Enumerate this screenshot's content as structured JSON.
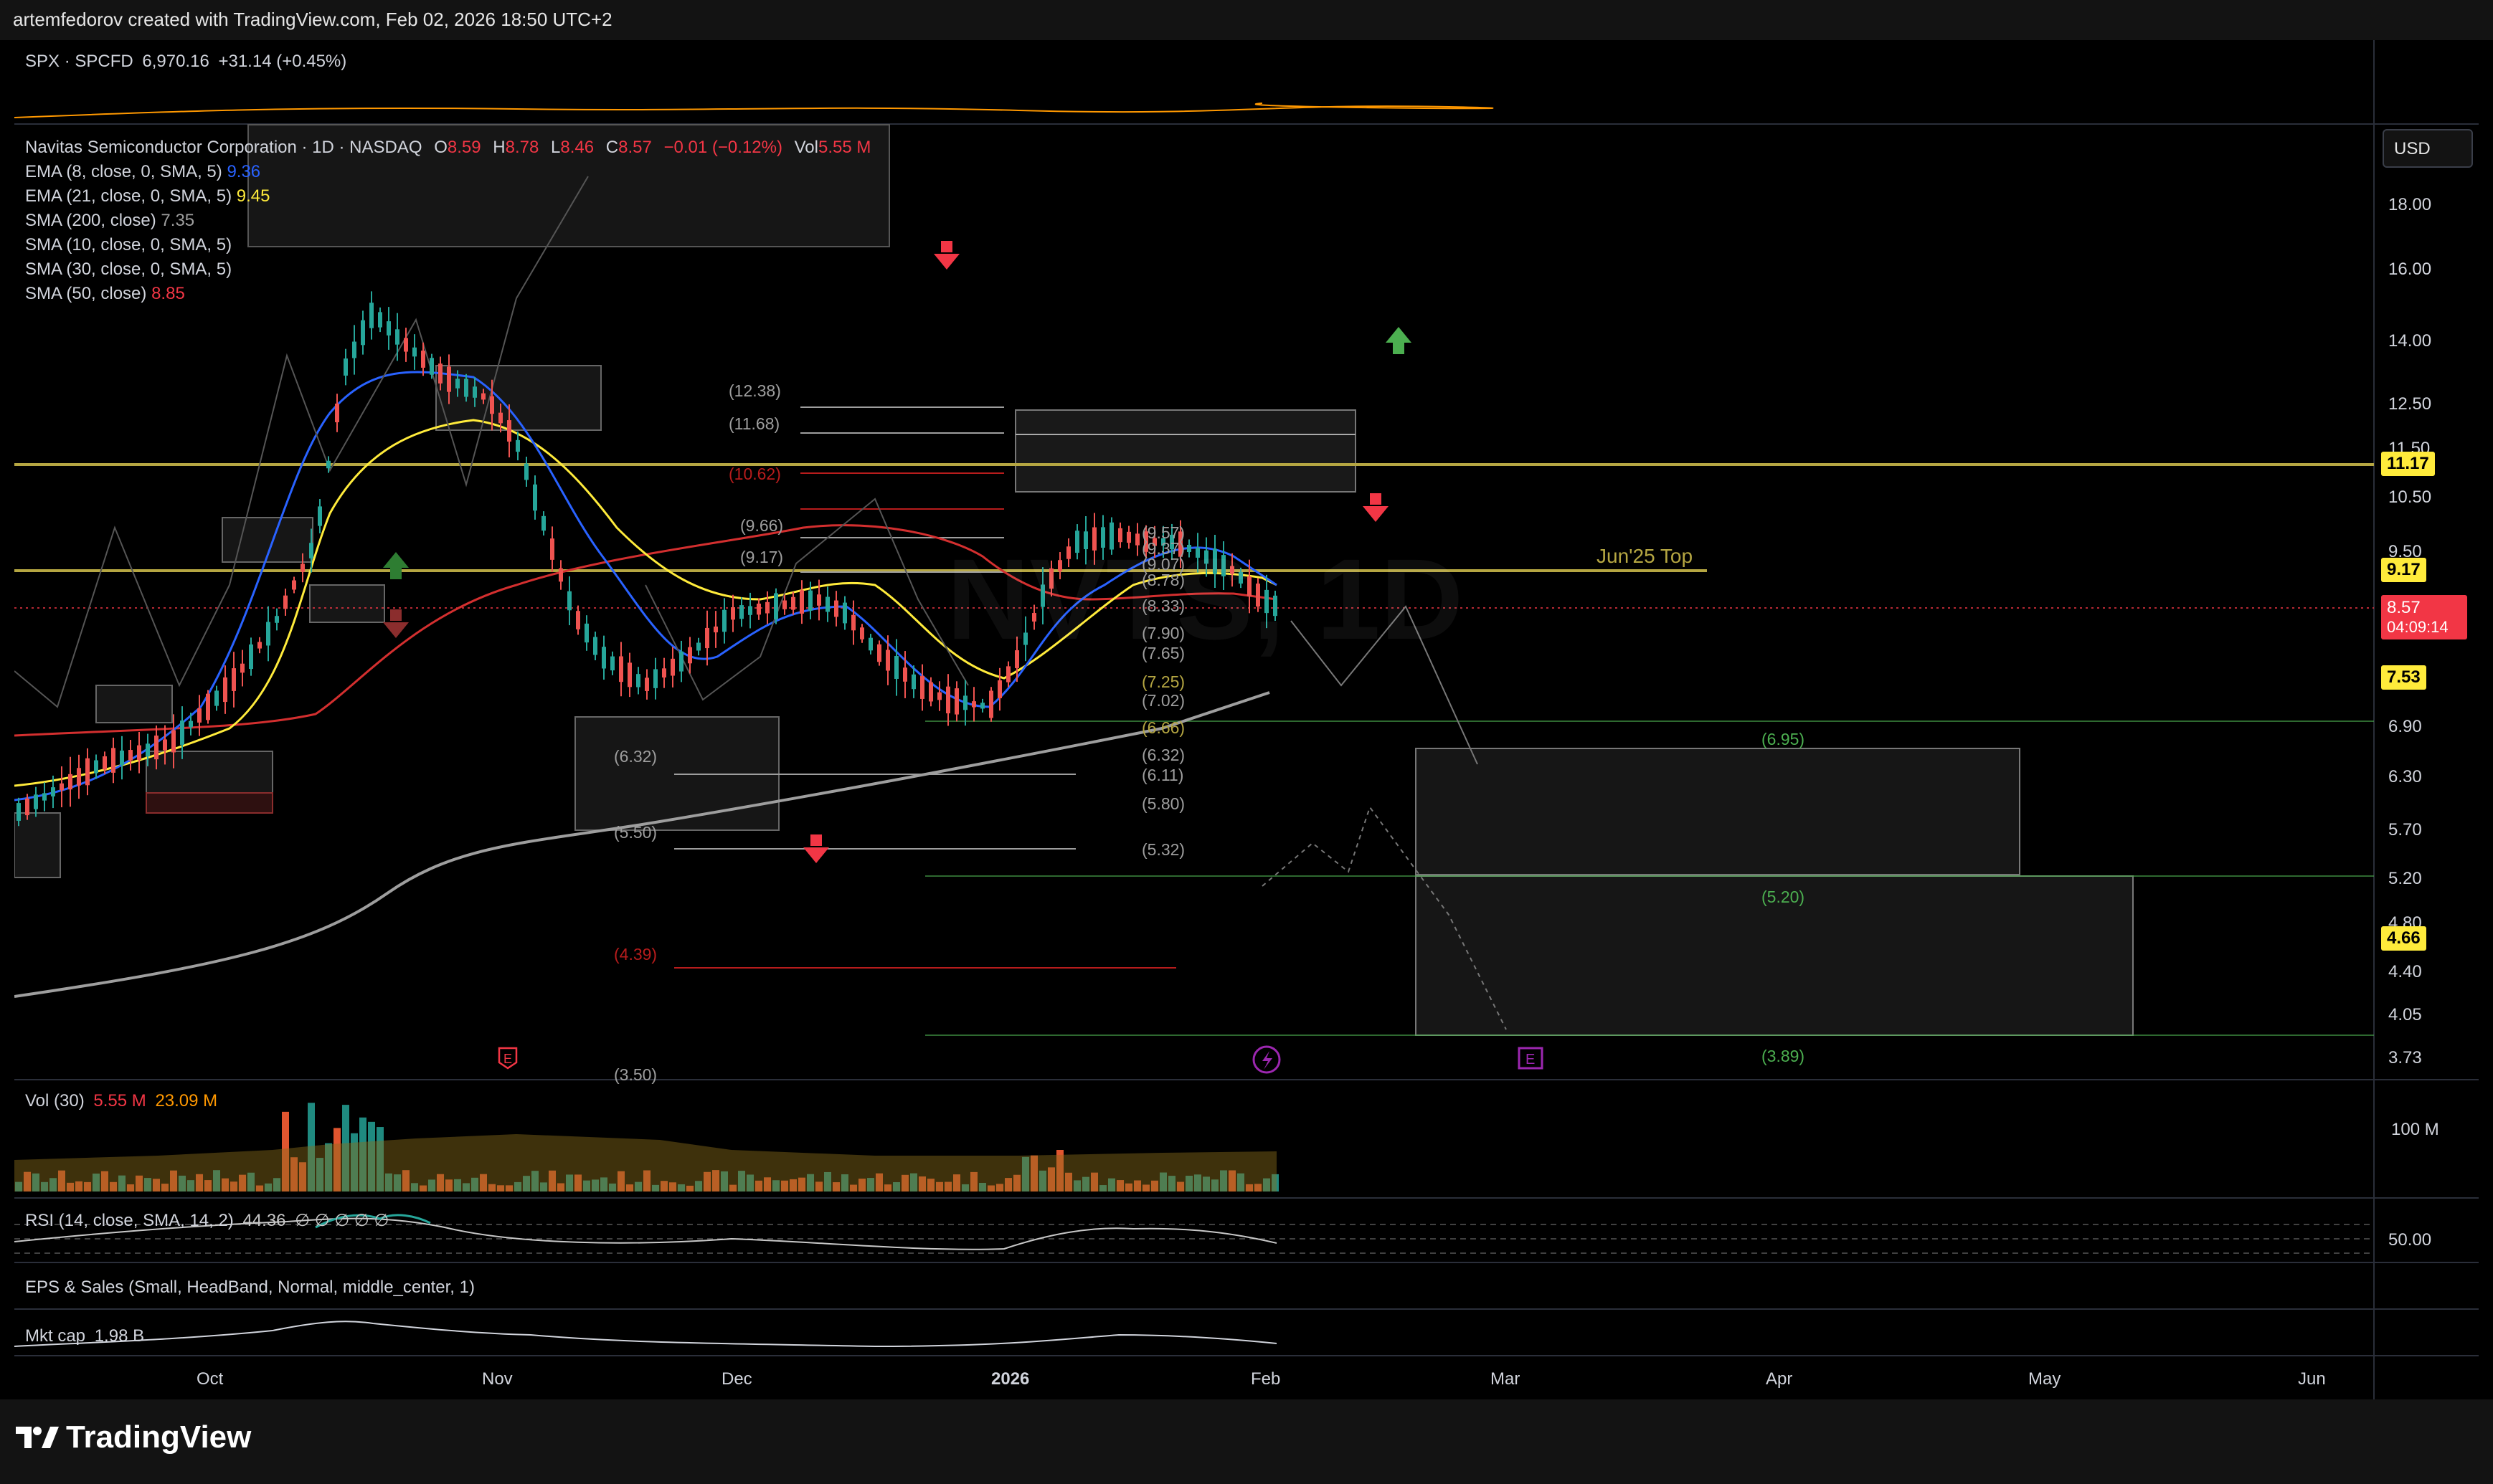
{
  "header": {
    "attribution": "artemfedorov created with TradingView.com, Feb 02, 2026 18:50 UTC+2"
  },
  "spx": {
    "label": "SPX · SPCFD",
    "price": "6,970.16",
    "change": "+31.14 (+0.45%)"
  },
  "symbol": {
    "name": "Navitas Semiconductor Corporation · 1D · NASDAQ",
    "o_label": "O",
    "o": "8.59",
    "h_label": "H",
    "h": "8.78",
    "l_label": "L",
    "l": "8.46",
    "c_label": "C",
    "c": "8.57",
    "change": "−0.01 (−0.12%)",
    "vol_label": "Vol",
    "vol": "5.55 M"
  },
  "indicators": [
    {
      "name": "EMA (8, close, 0, SMA, 5)",
      "value": "9.36",
      "color": "#2962ff"
    },
    {
      "name": "EMA (21, close, 0, SMA, 5)",
      "value": "9.45",
      "color": "#ffeb3b"
    },
    {
      "name": "SMA (200, close)",
      "value": "7.35",
      "color": "#9e9e9e"
    },
    {
      "name": "SMA (10, close, 0, SMA, 5)",
      "value": "",
      "color": "#d1d4dc"
    },
    {
      "name": "SMA (30, close, 0, SMA, 5)",
      "value": "",
      "color": "#d1d4dc"
    },
    {
      "name": "SMA (50, close)",
      "value": "8.85",
      "color": "#f23645"
    }
  ],
  "currency": "USD",
  "price_axis": [
    "18.00",
    "16.00",
    "14.00",
    "12.50",
    "11.50",
    "10.50",
    "9.50",
    "6.90",
    "6.30",
    "5.70",
    "5.20",
    "4.80",
    "4.40",
    "4.05",
    "3.73"
  ],
  "price_tags": [
    {
      "value": "11.17",
      "bg": "#ffeb3b",
      "fg": "#000000"
    },
    {
      "value": "9.17",
      "bg": "#ffeb3b",
      "fg": "#000000"
    },
    {
      "value": "8.57",
      "bg": "#f23645",
      "fg": "#ffffff",
      "sub": "04:09:14"
    },
    {
      "value": "7.53",
      "bg": "#ffeb3b",
      "fg": "#000000"
    },
    {
      "value": "4.66",
      "bg": "#ffeb3b",
      "fg": "#000000"
    }
  ],
  "annotation": {
    "jun_top": "Jun'25 Top",
    "watermark": "NVTS, 1D"
  },
  "fib_left": [
    "(12.38)",
    "(11.68)",
    "(10.62)",
    "(9.66)",
    "(9.17)",
    "(6.32)",
    "(5.50)",
    "(4.39)",
    "(3.50)"
  ],
  "fib_right": [
    "(9.57)",
    "(9.37)",
    "(9.07)",
    "(8.78)",
    "(8.33)",
    "(7.90)",
    "(7.65)",
    "(7.25)",
    "(7.02)",
    "(6.66)",
    "(6.32)",
    "(6.11)",
    "(5.80)",
    "(5.32)"
  ],
  "targets": [
    "(6.95)",
    "(5.20)",
    "(3.89)"
  ],
  "volume": {
    "label": "Vol (30)",
    "v1": "5.55 M",
    "v2": "23.09 M",
    "axis": "100 M"
  },
  "rsi": {
    "label": "RSI (14, close, SMA, 14, 2)",
    "value": "44.36",
    "ghost": "∅ ∅ ∅ ∅ ∅",
    "axis": "50.00"
  },
  "eps": {
    "label": "EPS & Sales (Small, HeadBand, Normal, middle_center, 1)"
  },
  "mktcap": {
    "label": "Mkt cap",
    "value": "1.98 B"
  },
  "time_axis": [
    "Oct",
    "Nov",
    "Dec",
    "2026",
    "Feb",
    "Mar",
    "Apr",
    "May",
    "Jun"
  ],
  "events": {
    "earnings": "E",
    "split": "⚡"
  },
  "brand": "TradingView",
  "colors": {
    "up": "#26a69a",
    "down": "#ef5350",
    "yellow": "#ffeb3b",
    "blue": "#2962ff",
    "red": "#f23645"
  }
}
